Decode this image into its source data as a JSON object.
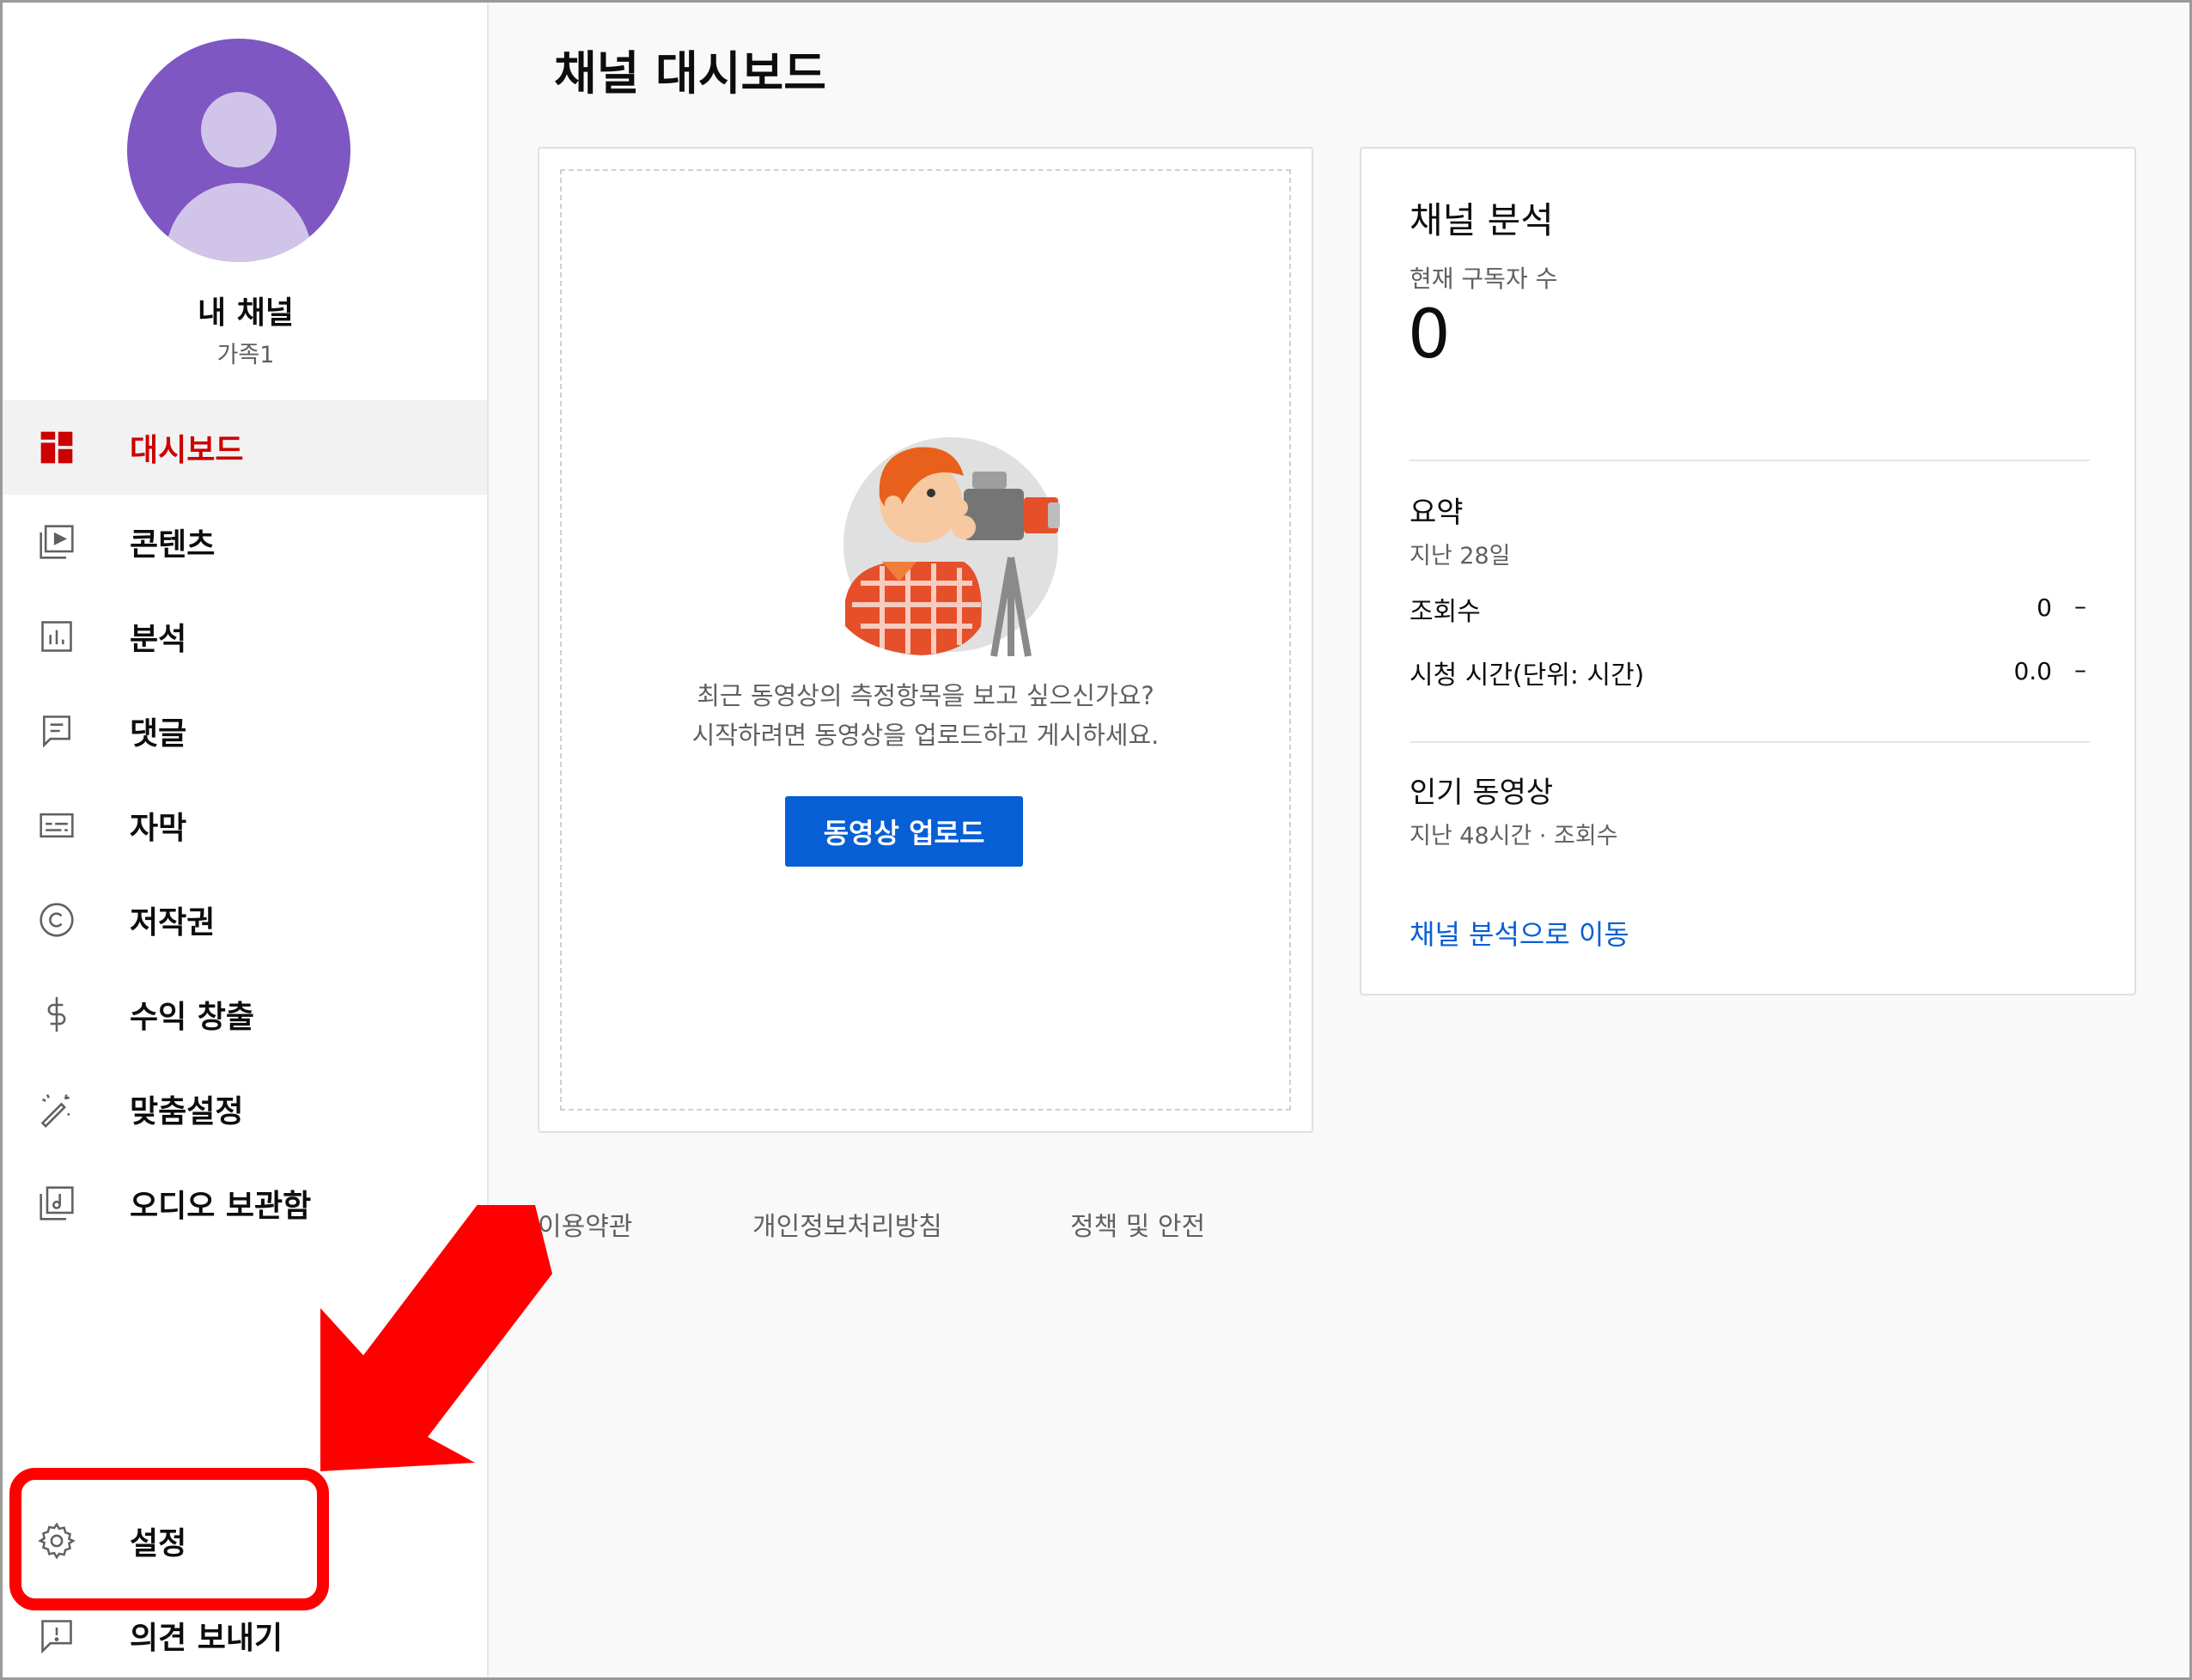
{
  "page_title": "채널 대시보드",
  "channel": {
    "name": "내 채널",
    "subtitle": "가족1"
  },
  "sidebar": {
    "items": [
      {
        "label": "대시보드",
        "icon": "dashboard-icon",
        "active": true
      },
      {
        "label": "콘텐츠",
        "icon": "content-icon"
      },
      {
        "label": "분석",
        "icon": "analytics-icon"
      },
      {
        "label": "댓글",
        "icon": "comments-icon"
      },
      {
        "label": "자막",
        "icon": "subtitles-icon"
      },
      {
        "label": "저작권",
        "icon": "copyright-icon"
      },
      {
        "label": "수익 창출",
        "icon": "monetization-icon"
      },
      {
        "label": "맞춤설정",
        "icon": "customization-icon"
      },
      {
        "label": "오디오 보관함",
        "icon": "audio-library-icon"
      }
    ],
    "bottom_items": [
      {
        "label": "설정",
        "icon": "gear-icon"
      },
      {
        "label": "의견 보내기",
        "icon": "feedback-icon"
      }
    ]
  },
  "upload_card": {
    "line1": "최근 동영상의 측정항목을 보고 싶으신가요?",
    "line2": "시작하려면 동영상을 업로드하고 게시하세요.",
    "button": "동영상 업로드"
  },
  "analytics": {
    "title": "채널 분석",
    "subscribers_label": "현재 구독자 수",
    "subscribers_value": "0",
    "summary_title": "요약",
    "summary_period": "지난 28일",
    "rows": [
      {
        "label": "조회수",
        "value": "0",
        "trend": "–"
      },
      {
        "label": "시청 시간(단위: 시간)",
        "value": "0.0",
        "trend": "–"
      }
    ],
    "popular_title": "인기 동영상",
    "popular_sub": "지난 48시간 · 조회수",
    "link": "채널 분석으로 이동"
  },
  "footer": {
    "links": [
      "이용약관",
      "개인정보처리방침",
      "정책 및 안전"
    ]
  },
  "colors": {
    "accent_red": "#cc0000",
    "brand_blue": "#065fd4",
    "avatar_purple": "#7e57c2",
    "annotation_red": "#ff0000"
  }
}
